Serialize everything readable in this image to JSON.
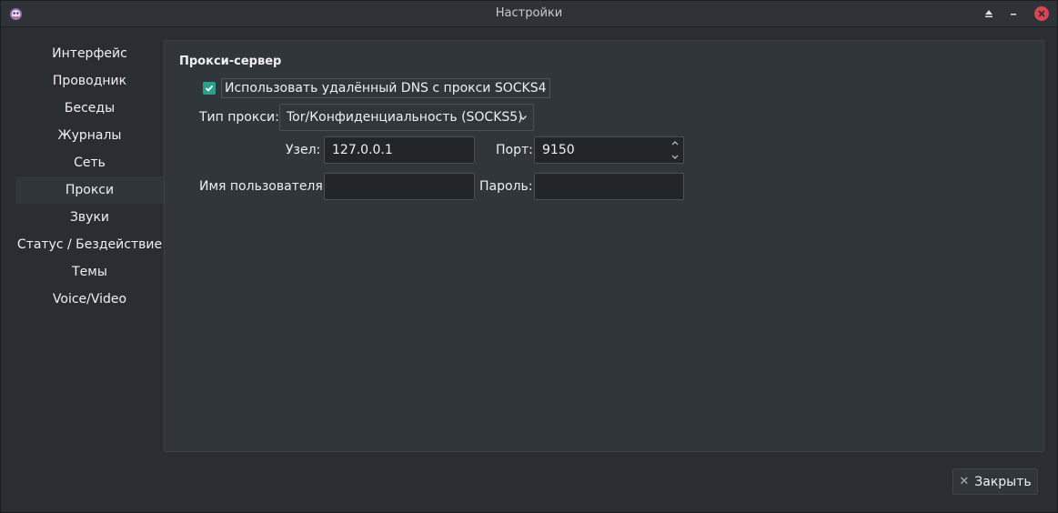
{
  "window": {
    "title": "Настройки"
  },
  "sidebar": {
    "items": [
      {
        "label": "Интерфейс"
      },
      {
        "label": "Проводник"
      },
      {
        "label": "Беседы"
      },
      {
        "label": "Журналы"
      },
      {
        "label": "Сеть"
      },
      {
        "label": "Прокси",
        "active": true
      },
      {
        "label": "Звуки"
      },
      {
        "label": "Статус / Бездействие"
      },
      {
        "label": "Темы"
      },
      {
        "label": "Voice/Video"
      }
    ]
  },
  "proxy": {
    "section_title": "Прокси-сервер",
    "remote_dns_label": "Использовать удалённый DNS с прокси SOCKS4",
    "remote_dns_checked": true,
    "type_label": "Тип прокси:",
    "type_value": "Tor/Конфиденциальность (SOCKS5)",
    "host_label": "Узел:",
    "host_value": "127.0.0.1",
    "port_label": "Порт:",
    "port_value": "9150",
    "username_label": "Имя пользователя:",
    "username_value": "",
    "password_label": "Пароль:",
    "password_value": ""
  },
  "footer": {
    "close_label": "Закрыть"
  },
  "colors": {
    "accent": "#2b9f8e",
    "close_window": "#da4453"
  },
  "icons": {
    "app": "app-logo-icon",
    "keep_above": "eject-icon",
    "minimize": "minimize-icon",
    "close": "close-icon",
    "dropdown": "chevron-down-icon",
    "spin_up": "chevron-up-icon",
    "spin_down": "chevron-down-icon",
    "checkbox": "checkmark-icon",
    "close_button": "close-x-icon"
  }
}
